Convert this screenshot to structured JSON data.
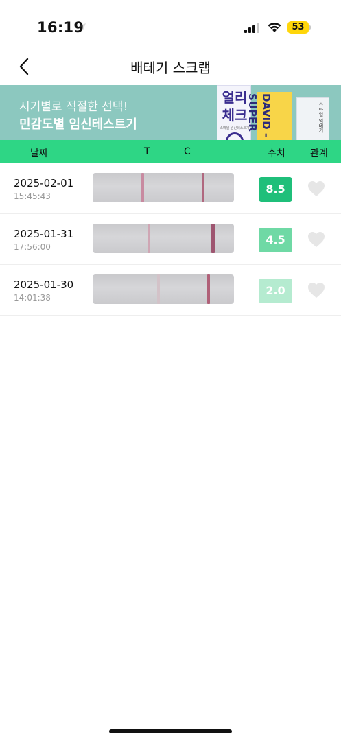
{
  "status_bar": {
    "time": "16:19",
    "battery_level": "53",
    "battery_color": "#ffd60a"
  },
  "nav": {
    "back_icon": "chevron-left-icon",
    "title": "배테기 스크랩"
  },
  "banner": {
    "line1": "시기별로 적절한 선택!",
    "line2": "민감도별 임신테스트기",
    "background": "#8cc8bf",
    "product1_name": "얼리\n체크",
    "product1_sub": "스마일 임신테스트기",
    "product2_name": "DAVID -SUPER",
    "product3_name": "스마일 임테기"
  },
  "table": {
    "header_color": "#2ed685",
    "columns": {
      "date": "날짜",
      "t": "T",
      "c": "C",
      "value": "수치",
      "relation": "관계"
    },
    "rows": [
      {
        "date": "2025-02-01",
        "time": "15:45:43",
        "value": "8.5",
        "badge_color": "#1fbf7a",
        "t_line_color": "#c88aa0",
        "c_line_color": "#b0687f",
        "heart_icon": "heart-icon"
      },
      {
        "date": "2025-01-31",
        "time": "17:56:00",
        "value": "4.5",
        "badge_color": "#6fd9a5",
        "t_line_color": "#cfa6b4",
        "c_line_color": "#9e5570",
        "heart_icon": "heart-icon"
      },
      {
        "date": "2025-01-30",
        "time": "14:01:38",
        "value": "2.0",
        "badge_color": "#b5ebd0",
        "t_line_color": "#d3c2c8",
        "c_line_color": "#b06078",
        "heart_icon": "heart-icon"
      }
    ]
  }
}
